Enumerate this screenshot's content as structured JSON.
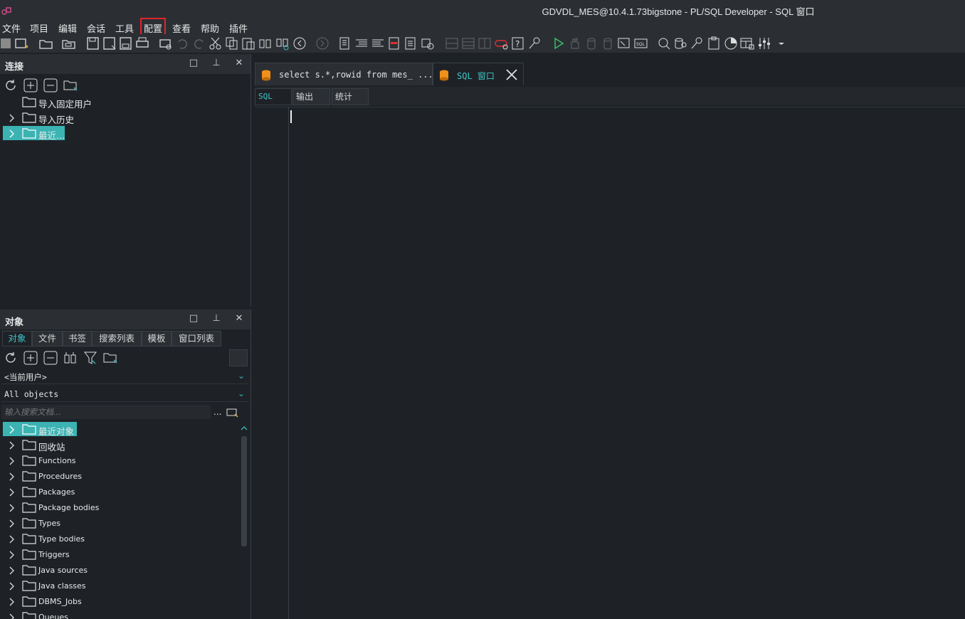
{
  "window": {
    "title": "GDVDL_MES@10.4.1.73bigstone - PL/SQL Developer - SQL 窗口"
  },
  "menu": {
    "items": [
      {
        "label": "文件"
      },
      {
        "label": "项目"
      },
      {
        "label": "编辑"
      },
      {
        "label": "会话"
      },
      {
        "label": "工具"
      },
      {
        "label": "配置"
      },
      {
        "label": "查看"
      },
      {
        "label": "帮助"
      },
      {
        "label": "插件"
      }
    ]
  },
  "connections_panel": {
    "title": "连接",
    "items": [
      {
        "label": "导入固定用户",
        "expandable": false
      },
      {
        "label": "导入历史",
        "expandable": true
      },
      {
        "label": "最近...",
        "expandable": true,
        "selected": true
      }
    ]
  },
  "objects_panel": {
    "title": "对象",
    "tabs": [
      {
        "label": "对象",
        "active": true
      },
      {
        "label": "文件"
      },
      {
        "label": "书签"
      },
      {
        "label": "搜索列表"
      },
      {
        "label": "模板"
      },
      {
        "label": "窗口列表"
      }
    ],
    "user_select": "<当前用户>",
    "filter_select": "All objects",
    "search_placeholder": "输入搜索文档...",
    "search_more": "...",
    "tree": [
      {
        "label": "最近对象",
        "selected": true
      },
      {
        "label": "回收站"
      },
      {
        "label": "Functions"
      },
      {
        "label": "Procedures"
      },
      {
        "label": "Packages"
      },
      {
        "label": "Package bodies"
      },
      {
        "label": "Types"
      },
      {
        "label": "Type bodies"
      },
      {
        "label": "Triggers"
      },
      {
        "label": "Java sources"
      },
      {
        "label": "Java classes"
      },
      {
        "label": "DBMS_Jobs"
      },
      {
        "label": "Queues"
      }
    ]
  },
  "editor": {
    "tabs": [
      {
        "label": "select s.*,rowid from mes_ ..."
      },
      {
        "label": "SQL 窗口",
        "active": true
      }
    ],
    "sub_tabs": [
      {
        "label": "SQL",
        "active": true
      },
      {
        "label": "输出"
      },
      {
        "label": "统计"
      }
    ]
  },
  "colors": {
    "accent": "#3bb3b3",
    "highlight_box": "#e0242a",
    "background": "#1e2227"
  }
}
